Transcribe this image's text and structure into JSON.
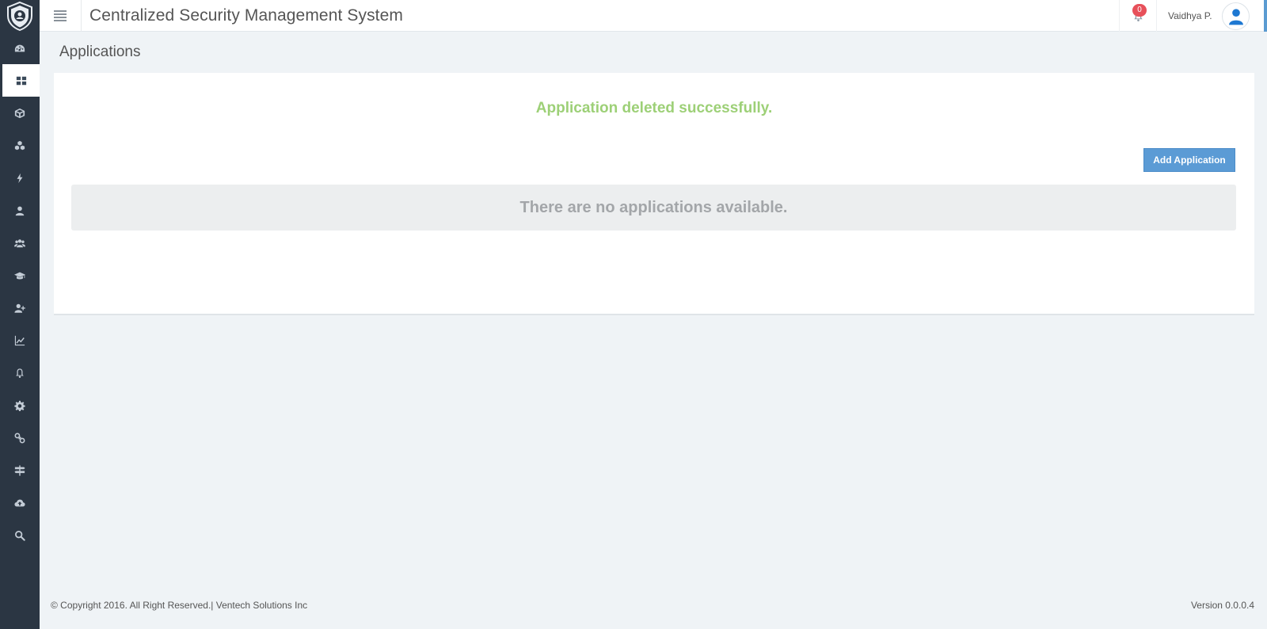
{
  "app": {
    "title": "Centralized Security Management System",
    "notifications_count": "0",
    "user_name": "Vaidhya P."
  },
  "sidebar": {
    "items": [
      {
        "icon": "dashboard-icon",
        "active": false
      },
      {
        "icon": "applications-grid-icon",
        "active": true
      },
      {
        "icon": "cube-icon",
        "active": false
      },
      {
        "icon": "cubes-icon",
        "active": false
      },
      {
        "icon": "bolt-icon",
        "active": false
      },
      {
        "icon": "user-icon",
        "active": false
      },
      {
        "icon": "users-icon",
        "active": false
      },
      {
        "icon": "graduation-cap-icon",
        "active": false
      },
      {
        "icon": "user-plus-icon",
        "active": false
      },
      {
        "icon": "line-chart-icon",
        "active": false
      },
      {
        "icon": "bell-icon",
        "active": false
      },
      {
        "icon": "gear-icon",
        "active": false
      },
      {
        "icon": "link-icon",
        "active": false
      },
      {
        "icon": "signpost-icon",
        "active": false
      },
      {
        "icon": "cloud-upload-icon",
        "active": false
      },
      {
        "icon": "search-icon",
        "active": false
      }
    ]
  },
  "page": {
    "title": "Applications",
    "success_message": "Application deleted successfully.",
    "add_button_label": "Add Application",
    "empty_message": "There are no applications available."
  },
  "footer": {
    "copyright": "© Copyright 2016. All Right Reserved.| Ventech Solutions Inc",
    "version": "Version 0.0.0.4"
  },
  "colors": {
    "sidebar_bg": "#2b3643",
    "success_green": "#9dd077",
    "primary_button": "#5b9bd5",
    "badge_red": "#e7505a"
  }
}
